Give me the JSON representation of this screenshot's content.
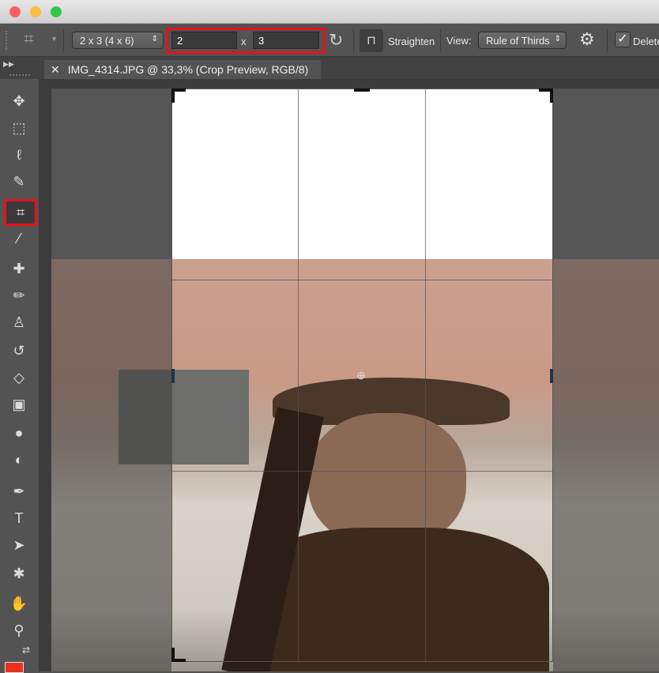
{
  "window": {
    "traffic_lights": [
      "#fc605c",
      "#fdbc40",
      "#34c84a"
    ]
  },
  "options": {
    "preset": "2 x 3 (4 x 6)",
    "width": "2",
    "x_label": "x",
    "height": "3",
    "straighten_label": "Straighten",
    "view_label": "View:",
    "view_value": "Rule of Thirds",
    "delete_label": "Delete",
    "highlight_color": "#e8101a"
  },
  "tab": {
    "title": "IMG_4314.JPG @ 33,3% (Crop Preview, RGB/8)"
  },
  "tools": [
    {
      "name": "move-tool",
      "icon": "✥"
    },
    {
      "name": "marquee-tool",
      "icon": "⬚"
    },
    {
      "name": "lasso-tool",
      "icon": "ℓ"
    },
    {
      "name": "quick-select-tool",
      "icon": "✎"
    },
    {
      "name": "crop-tool",
      "icon": "⌗"
    },
    {
      "name": "eyedropper-tool",
      "icon": "⁄"
    },
    {
      "name": "healing-tool",
      "icon": "✚"
    },
    {
      "name": "brush-tool",
      "icon": "✏"
    },
    {
      "name": "stamp-tool",
      "icon": "♙"
    },
    {
      "name": "history-brush-tool",
      "icon": "↺"
    },
    {
      "name": "eraser-tool",
      "icon": "◇"
    },
    {
      "name": "gradient-tool",
      "icon": "▣"
    },
    {
      "name": "blur-tool",
      "icon": "●"
    },
    {
      "name": "dodge-tool",
      "icon": "◐"
    },
    {
      "name": "pen-tool",
      "icon": "✒"
    },
    {
      "name": "type-tool",
      "icon": "T"
    },
    {
      "name": "path-select-tool",
      "icon": "➤"
    },
    {
      "name": "shape-tool",
      "icon": "✱"
    },
    {
      "name": "hand-tool",
      "icon": "✋"
    },
    {
      "name": "zoom-tool",
      "icon": "⚲"
    }
  ],
  "foreground_color": "#e8311f"
}
